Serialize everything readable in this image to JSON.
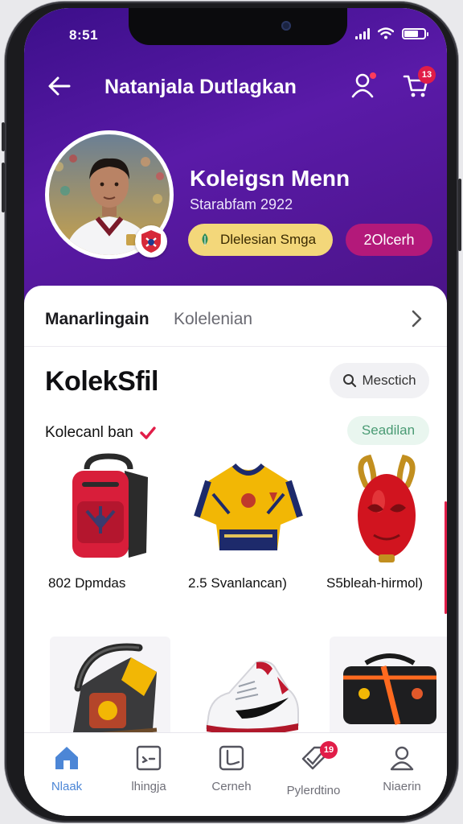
{
  "status_bar": {
    "time": "8:51"
  },
  "header": {
    "title": "Natanjala Dutlagkan",
    "cart_count": "13"
  },
  "profile": {
    "name": "Koleigsn Menn",
    "subtitle": "Starabfam 2922",
    "badge_gold": "Dlelesian Smga",
    "badge_pink": "2Olcerh"
  },
  "tabs": {
    "active": "Manarlingain",
    "second": "Kolelenian"
  },
  "section": {
    "title": "KolekSfil",
    "search_label": "Mesctich",
    "subtitle": "Kolecanl ban",
    "save_label": "Seadilan"
  },
  "items_row1": [
    {
      "caption": "802 Dpmdas",
      "icon": "red-backpack"
    },
    {
      "caption": "2.5 Svanlancan)",
      "icon": "yellow-jersey"
    },
    {
      "caption": "S5bleah-hirmol)",
      "icon": "red-mask"
    }
  ],
  "items_row2": [
    {
      "icon": "black-bag-headphones"
    },
    {
      "icon": "white-sneaker"
    },
    {
      "icon": "black-duffel-bag"
    }
  ],
  "bottom_nav": [
    {
      "label": "Nlaak",
      "icon": "home-icon",
      "active": true
    },
    {
      "label": "lhingja",
      "icon": "chat-icon"
    },
    {
      "label": "Cerneh",
      "icon": "gallery-icon"
    },
    {
      "label": "Pylerdtino",
      "icon": "tag-icon",
      "badge": "19"
    },
    {
      "label": "Niaerin",
      "icon": "profile-icon"
    }
  ],
  "colors": {
    "hero": "#4a148c",
    "accent_pink": "#b3197a",
    "badge_red": "#e11d48",
    "active_blue": "#4c86d6"
  }
}
